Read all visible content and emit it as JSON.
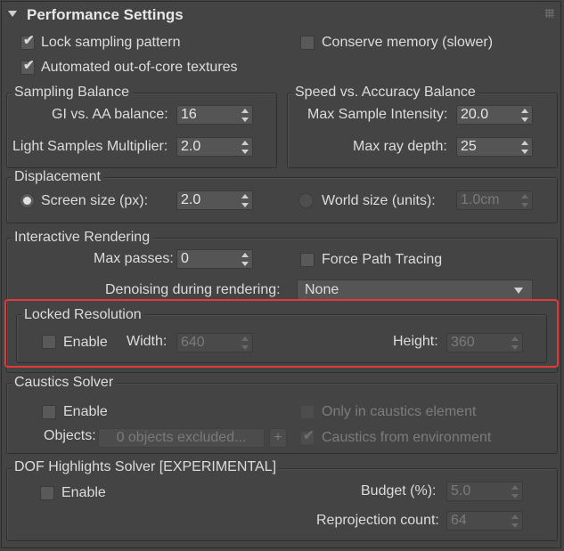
{
  "header": {
    "title": "Performance Settings",
    "collapse_icon": "triangle-down-icon",
    "grip_icon": "grip-icon"
  },
  "top": {
    "lock_sampling": {
      "label": "Lock sampling pattern",
      "checked": true
    },
    "conserve_memory": {
      "label": "Conserve memory (slower)",
      "checked": false
    },
    "out_of_core": {
      "label": "Automated out-of-core textures",
      "checked": true
    }
  },
  "sampling_balance": {
    "title": "Sampling Balance",
    "gi_aa_label": "GI vs. AA balance:",
    "gi_aa_value": "16",
    "light_mult_label": "Light Samples Multiplier:",
    "light_mult_value": "2.0"
  },
  "speed_accuracy": {
    "title": "Speed vs. Accuracy Balance",
    "max_intensity_label": "Max Sample Intensity:",
    "max_intensity_value": "20.0",
    "max_depth_label": "Max ray depth:",
    "max_depth_value": "25"
  },
  "displacement": {
    "title": "Displacement",
    "screen_label": "Screen size (px):",
    "screen_value": "2.0",
    "screen_selected": true,
    "world_label": "World size (units):",
    "world_value": "1.0cm"
  },
  "interactive": {
    "title": "Interactive Rendering",
    "max_passes_label": "Max passes:",
    "max_passes_value": "0",
    "force_path_label": "Force Path Tracing",
    "denoise_label": "Denoising during rendering:",
    "denoise_value": "None"
  },
  "locked_resolution": {
    "title": "Locked Resolution",
    "enable_label": "Enable",
    "width_label": "Width:",
    "width_value": "640",
    "height_label": "Height:",
    "height_value": "360"
  },
  "caustics": {
    "title": "Caustics Solver",
    "enable_label": "Enable",
    "only_caustics_label": "Only in caustics element",
    "objects_label": "Objects:",
    "objects_button": "0 objects excluded...",
    "add_button": "+",
    "from_env_label": "Caustics from environment"
  },
  "dof": {
    "title": "DOF Highlights Solver [EXPERIMENTAL]",
    "enable_label": "Enable",
    "budget_label": "Budget (%):",
    "budget_value": "5.0",
    "reprojection_label": "Reprojection count:",
    "reprojection_value": "64"
  },
  "colors": {
    "background": "#444444",
    "highlight": "#e03a3a",
    "text": "#dcdcdc",
    "disabled_text": "#7c7c7c"
  }
}
